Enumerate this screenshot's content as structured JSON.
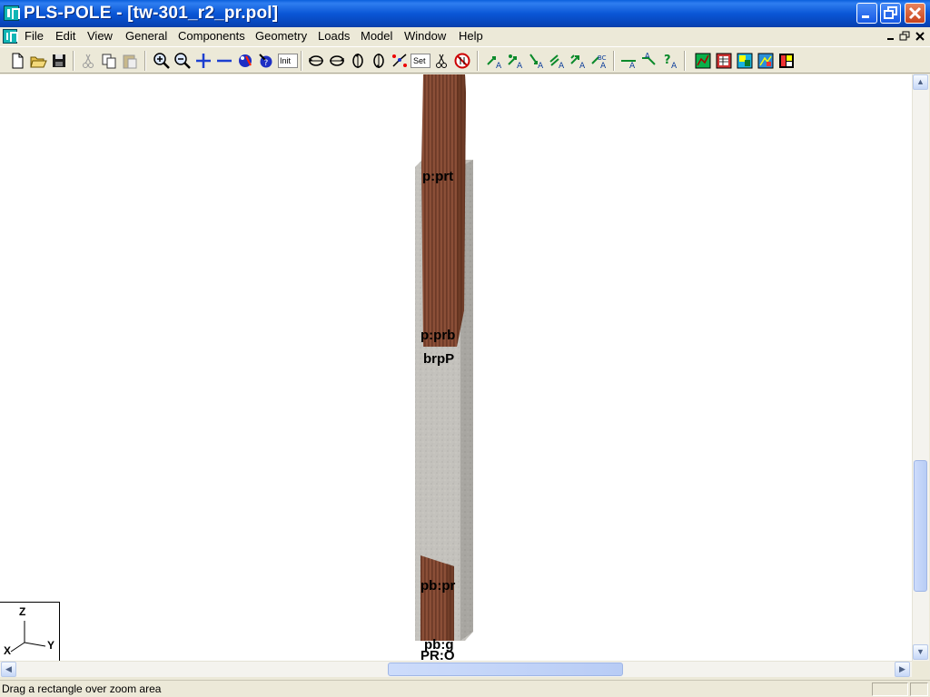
{
  "window": {
    "title": "PLS-POLE - [tw-301_r2_pr.pol]"
  },
  "menu": {
    "items": [
      "File",
      "Edit",
      "View",
      "General",
      "Components",
      "Geometry",
      "Loads",
      "Model",
      "Window",
      "Help"
    ]
  },
  "toolbar": {
    "init_label": "Init",
    "set_label": "Set"
  },
  "canvas": {
    "labels": {
      "prt": "p:prt",
      "prb": "p:prb",
      "brpp": "brpP",
      "pbpr": "pb:pr",
      "pbg": "pb:g",
      "pro": "PR:O"
    },
    "axes": {
      "z": "Z",
      "x": "X",
      "y": "Y"
    }
  },
  "status": {
    "message": "Drag a rectangle over zoom area"
  },
  "colors": {
    "titlebar": "#0a56d6",
    "wood": "#8a4e36",
    "concrete": "#c4c2bd"
  }
}
